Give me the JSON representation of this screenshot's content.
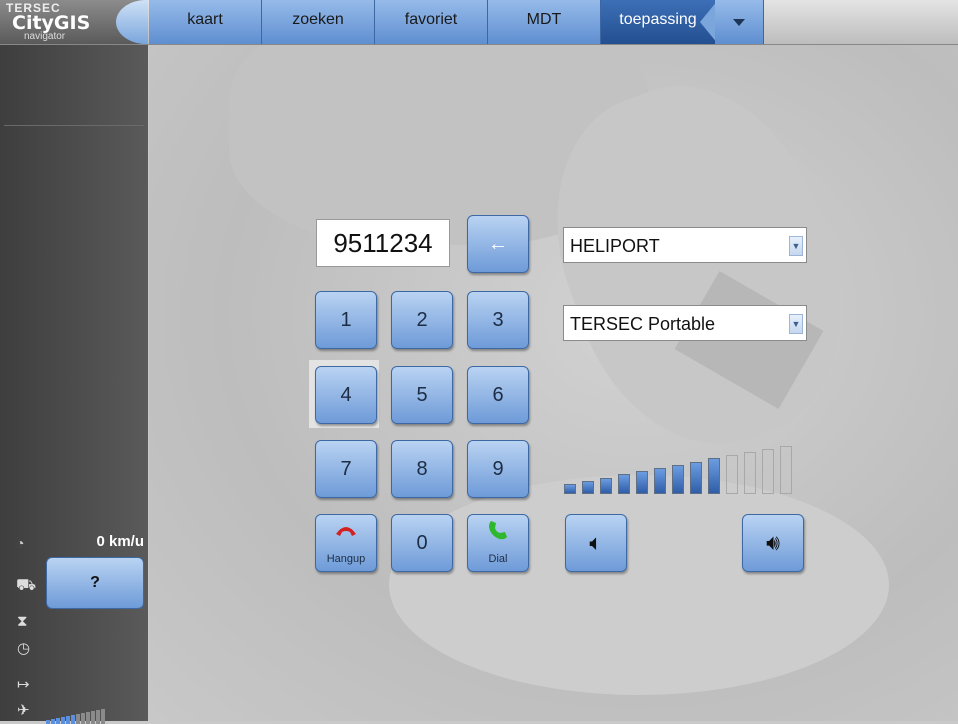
{
  "logo": {
    "brand_top": "TERSEC",
    "brand_main": "CityGIS",
    "brand_sub": "navigator"
  },
  "tabs": [
    {
      "label": "kaart"
    },
    {
      "label": "zoeken"
    },
    {
      "label": "favoriet"
    },
    {
      "label": "MDT"
    },
    {
      "label": "toepassing",
      "active": true
    }
  ],
  "sidebar": {
    "speed": "0 km/u",
    "unit_button": "?",
    "icons": [
      "speedometer-icon",
      "vehicle-icon",
      "hourglass-icon",
      "clock-icon",
      "direction-arrow-icon",
      "gps-satellite-icon"
    ],
    "gps_signal_bars": {
      "filled": 6,
      "total": 12
    }
  },
  "dialer": {
    "number": "9511234",
    "backspace_icon": "←",
    "keys": [
      "1",
      "2",
      "3",
      "4",
      "5",
      "6",
      "7",
      "8",
      "9",
      "0"
    ],
    "hangup_label": "Hangup",
    "dial_label": "Dial",
    "hangup_color": "#d32020",
    "dial_color": "#2db82d"
  },
  "destination_select": {
    "value": "HELIPORT"
  },
  "device_select": {
    "value": "TERSEC Portable"
  },
  "volume": {
    "level": 9,
    "max": 13,
    "down_icon": "speaker-low-icon",
    "up_icon": "speaker-high-icon"
  },
  "colors": {
    "accent": "#6e9bd8",
    "active_tab": "#234f90"
  }
}
